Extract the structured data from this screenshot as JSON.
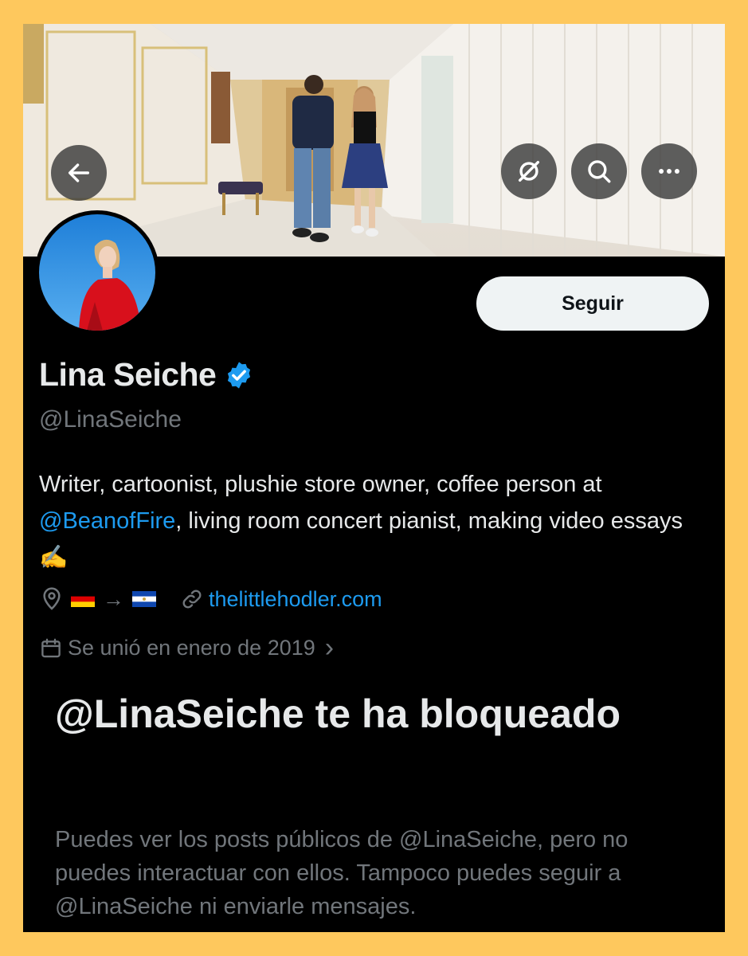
{
  "header": {
    "back_button_icon": "arrow-left-icon",
    "actions": [
      "grok-icon",
      "search-icon",
      "more-icon"
    ]
  },
  "profile": {
    "display_name": "Lina Seiche",
    "handle": "@LinaSeiche",
    "verified": true,
    "follow_label": "Seguir",
    "bio_part1": "Writer, cartoonist, plushie store owner, coffee person at ",
    "bio_mention": "@BeanofFire",
    "bio_part2": ", living room concert pianist, making video essays ✍️",
    "location_arrow": "→",
    "location_icon": "location-pin-icon",
    "link_icon": "link-icon",
    "website": "thelittlehodler.com",
    "joined": "Se unió en enero de 2019",
    "joined_chevron": "›"
  },
  "blocked": {
    "title": "@LinaSeiche te ha bloqueado",
    "description": "Puedes ver los posts públicos de @LinaSeiche, pero no puedes interactuar con ellos. Tampoco puedes seguir a @LinaSeiche ni enviarle mensajes."
  },
  "colors": {
    "page_background": "#fec85d",
    "card_background": "#000000",
    "primary_text": "#e7e9ea",
    "secondary_text": "#71767b",
    "accent": "#1d9bf0",
    "follow_button_bg": "#eff3f4"
  }
}
